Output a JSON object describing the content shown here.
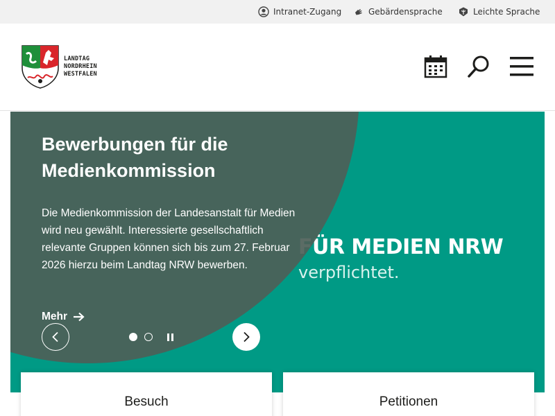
{
  "utility": {
    "intranet_label": "Intranet-Zugang",
    "gebaerde_label": "Gebärdensprache",
    "leicht_label": "Leichte Sprache"
  },
  "header": {
    "logo_line1": "LANDTAG",
    "logo_line2": "NORDRHEIN",
    "logo_line3": "WESTFALEN"
  },
  "hero": {
    "title": "Bewerbungen für die Medienkommission",
    "description": "Die Medienkommission der Landesanstalt für Medien wird neu gewählt. Interessierte gesellschaftlich relevante Gruppen können sich bis zum 27. Februar 2026 hierzu beim Landtag NRW bewerben.",
    "more_label": "Mehr",
    "bg_text_line1": "FÜR MEDIEN NRW",
    "bg_text_line2": "verpflichtet."
  },
  "slider": {
    "slide_count": 2,
    "active_slide": 1
  },
  "cards": [
    {
      "title": "Besuch"
    },
    {
      "title": "Petitionen"
    }
  ],
  "colors": {
    "hero_teal": "#009a85",
    "hero_overlay": "#4d5f58",
    "utility_bg": "#f1f1f1"
  }
}
